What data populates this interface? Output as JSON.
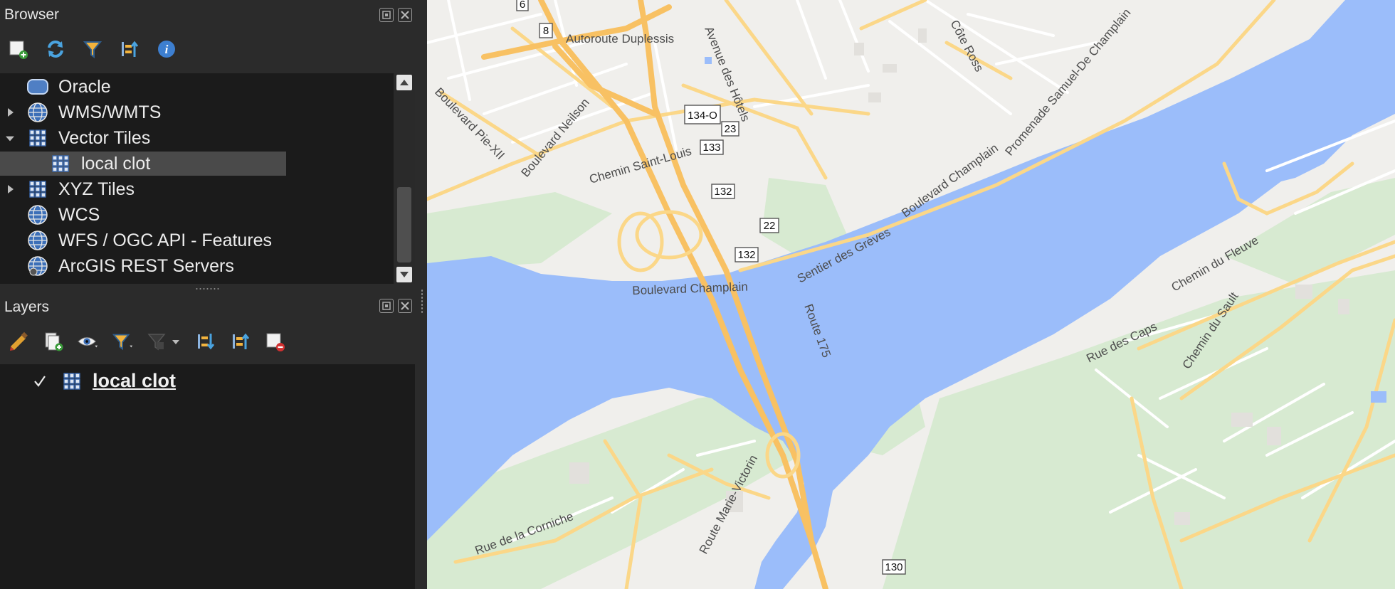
{
  "browser": {
    "title": "Browser",
    "toolbar": [
      {
        "name": "add-layer-icon"
      },
      {
        "name": "refresh-icon"
      },
      {
        "name": "filter-icon"
      },
      {
        "name": "collapse-all-icon"
      },
      {
        "name": "info-icon"
      }
    ],
    "items": [
      {
        "label": "Oracle",
        "icon": "database-icon",
        "expander": "none",
        "indent": 0
      },
      {
        "label": "WMS/WMTS",
        "icon": "globe-icon",
        "expander": "collapsed",
        "indent": 0
      },
      {
        "label": "Vector Tiles",
        "icon": "grid-icon",
        "expander": "expanded",
        "indent": 0
      },
      {
        "label": "local clot",
        "icon": "grid-icon",
        "expander": "none",
        "indent": 1,
        "selected": true
      },
      {
        "label": "XYZ Tiles",
        "icon": "grid-icon",
        "expander": "collapsed",
        "indent": 0
      },
      {
        "label": "WCS",
        "icon": "globe-icon",
        "expander": "none",
        "indent": 0
      },
      {
        "label": "WFS / OGC API - Features",
        "icon": "globe-icon",
        "expander": "none",
        "indent": 0
      },
      {
        "label": "ArcGIS REST Servers",
        "icon": "globe-icon",
        "expander": "none",
        "indent": 0
      }
    ]
  },
  "layers": {
    "title": "Layers",
    "toolbar": [
      {
        "name": "style-brush-icon"
      },
      {
        "name": "add-group-icon"
      },
      {
        "name": "visibility-eye-icon"
      },
      {
        "name": "filter-legend-icon"
      },
      {
        "name": "expression-filter-icon"
      },
      {
        "name": "expand-all-icon"
      },
      {
        "name": "collapse-all-icon"
      },
      {
        "name": "remove-layer-icon"
      }
    ],
    "items": [
      {
        "label": "local clot",
        "checked": true,
        "icon": "grid-icon"
      }
    ]
  },
  "map": {
    "streets": {
      "autoroute_duplessis": "Autoroute Duplessis",
      "avenue_des_hotels": "Avenue des Hôtels",
      "cote_ross": "Côte Ross",
      "boulevard_neilson": "Boulevard Neilson",
      "boulevard_pie_xii": "Boulevard Pie-XII",
      "chemin_saint_louis": "Chemin Saint-Louis",
      "promenade": "Promenade Samuel-De Champlain",
      "boulevard_champlain_ne": "Boulevard Champlain",
      "boulevard_champlain_sw": "Boulevard Champlain",
      "sentier_des_greves": "Sentier des Grèves",
      "route_175": "Route 175",
      "chemin_du_fleuve": "Chemin du Fleuve",
      "rue_des_caps": "Rue des Caps",
      "chemin_du_sault": "Chemin du Sault",
      "route_marie_victorin": "Route Marie-Victorin",
      "rue_de_la_corniche": "Rue de la Corniche"
    },
    "shields": {
      "s6": "6",
      "s8": "8",
      "s134o": "134-O",
      "s23": "23",
      "s133": "133",
      "s132a": "132",
      "s22": "22",
      "s132b": "132",
      "s130": "130"
    },
    "colors": {
      "water": "#9bbdfa",
      "land": "#f0efec",
      "park": "#d7ead1",
      "highway": "#f8c163",
      "arterial": "#fbd788",
      "minor": "#ffffff"
    }
  }
}
